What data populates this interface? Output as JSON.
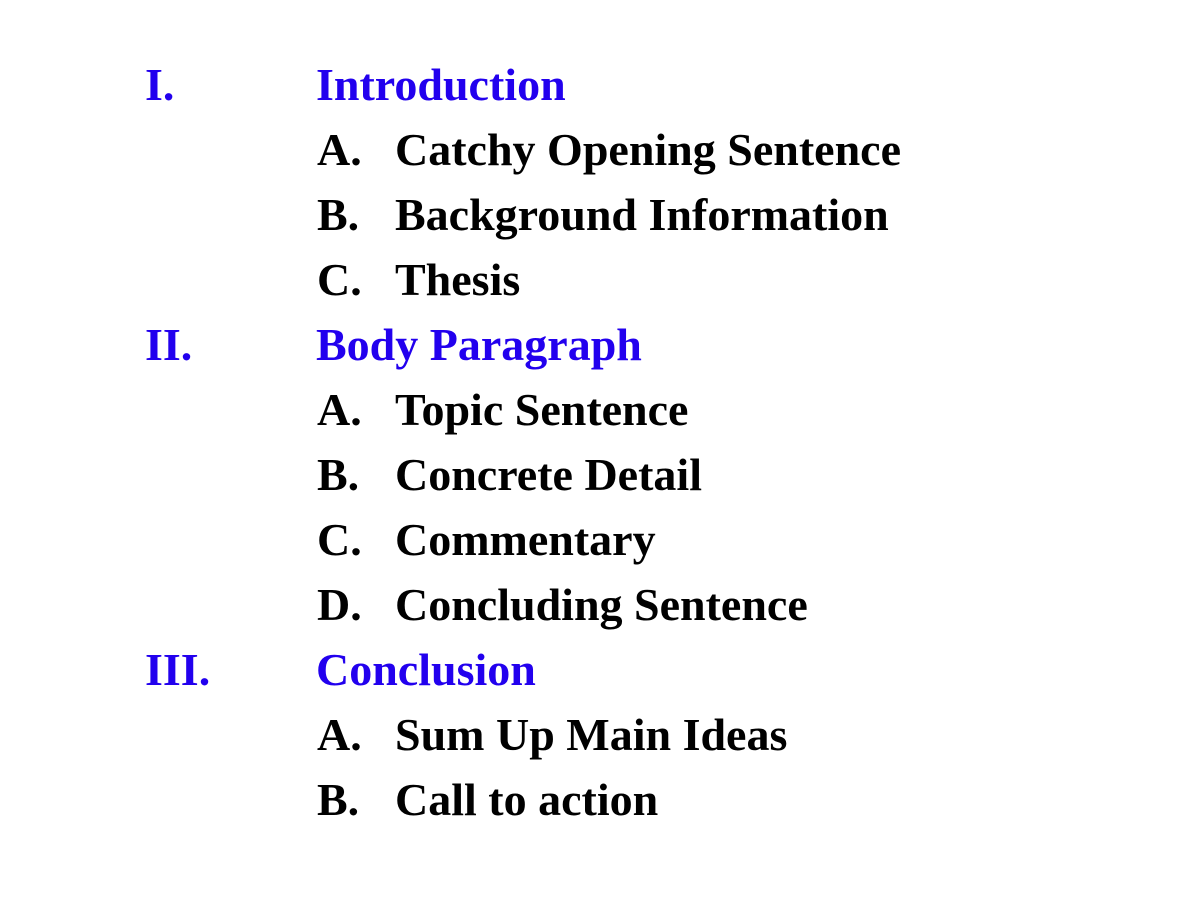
{
  "document": {
    "background_color": "#ffffff",
    "heading_color": "#2200ee",
    "subitem_color": "#000000",
    "rows": [
      {
        "level": "main",
        "marker": "I.",
        "text": "Introduction"
      },
      {
        "level": "sub",
        "marker": "A.",
        "text": "Catchy Opening Sentence"
      },
      {
        "level": "sub",
        "marker": "B.",
        "text": "Background Information"
      },
      {
        "level": "sub",
        "marker": "C.",
        "text": "Thesis"
      },
      {
        "level": "main",
        "marker": "II.",
        "text": "Body Paragraph"
      },
      {
        "level": "sub",
        "marker": "A.",
        "text": "Topic Sentence"
      },
      {
        "level": "sub",
        "marker": "B.",
        "text": "Concrete Detail"
      },
      {
        "level": "sub",
        "marker": "C.",
        "text": "Commentary"
      },
      {
        "level": "sub",
        "marker": "D.",
        "text": "Concluding Sentence"
      },
      {
        "level": "main",
        "marker": "III.",
        "text": "Conclusion"
      },
      {
        "level": "sub",
        "marker": "A.",
        "text": "Sum Up Main Ideas"
      },
      {
        "level": "sub",
        "marker": "B.",
        "text": "Call to action"
      }
    ]
  }
}
